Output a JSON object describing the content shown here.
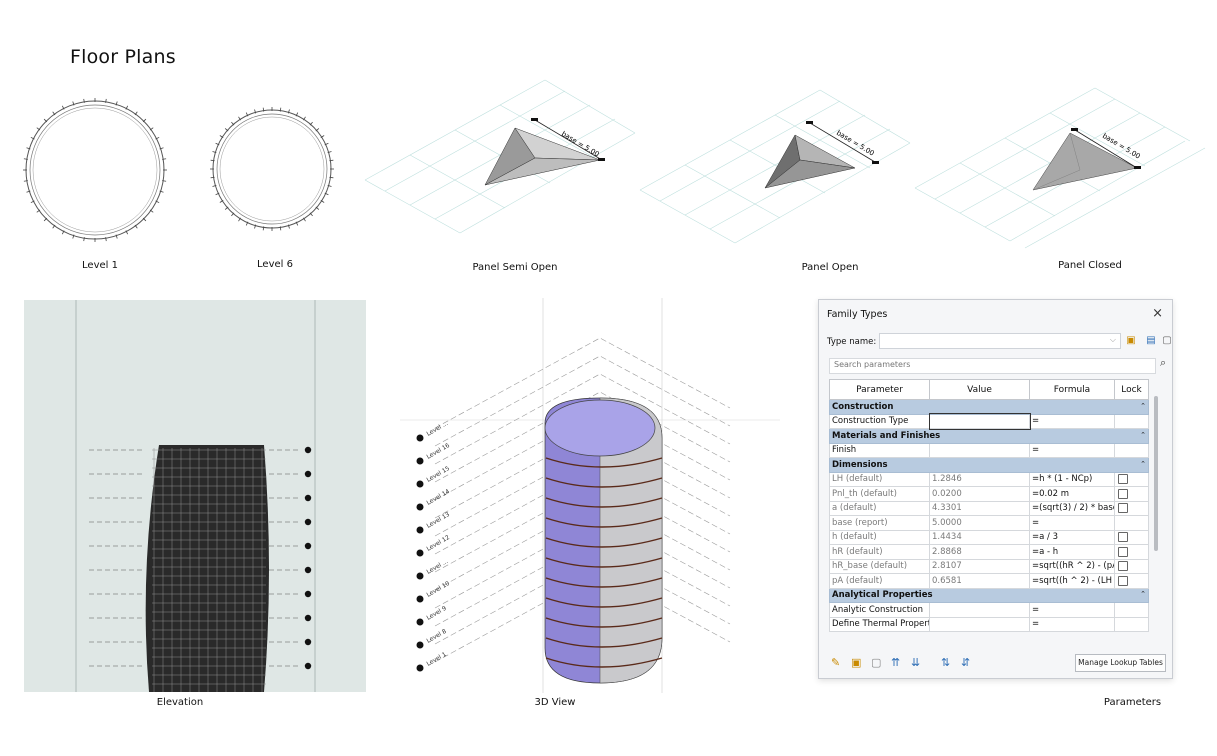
{
  "heading": "Floor Plans",
  "captions": {
    "level1": "Level 1",
    "level6": "Level 6",
    "panel_semi_open": "Panel Semi Open",
    "panel_open": "Panel Open",
    "panel_closed": "Panel Closed",
    "elevation": "Elevation",
    "view_3d": "3D View",
    "parameters": "Parameters"
  },
  "dimension_label": "base = 5.00",
  "elevation_level_count": 10,
  "view3d_levels": [
    "Level ...",
    "Level 16",
    "Level 15",
    "Level 14",
    "Level 13",
    "Level 12",
    "Level ...",
    "Level 10",
    "Level 9",
    "Level 8",
    "Level 1"
  ],
  "dialog": {
    "title": "Family Types",
    "close": "×",
    "type_name_label": "Type name:",
    "type_name_value": "",
    "search_placeholder": "Search parameters",
    "columns": [
      "Parameter",
      "Value",
      "Formula",
      "Lock"
    ],
    "groups": {
      "construction": "Construction",
      "materials": "Materials and Finishes",
      "dimensions": "Dimensions",
      "analytical": "Analytical Properties"
    },
    "rows": {
      "construction_type": {
        "param": "Construction Type",
        "value": "",
        "formula": "="
      },
      "finish": {
        "param": "Finish",
        "value": "",
        "formula": "="
      },
      "lh": {
        "param": "LH (default)",
        "value": "1.2846",
        "formula": "=h * (1 - NCp)"
      },
      "pnl_th": {
        "param": "Pnl_th (default)",
        "value": "0.0200",
        "formula": "=0.02 m"
      },
      "a": {
        "param": "a (default)",
        "value": "4.3301",
        "formula": "=(sqrt(3) / 2) * base"
      },
      "base": {
        "param": "base (report)",
        "value": "5.0000",
        "formula": "="
      },
      "h": {
        "param": "h (default)",
        "value": "1.4434",
        "formula": "=a / 3"
      },
      "hr": {
        "param": "hR (default)",
        "value": "2.8868",
        "formula": "=a - h"
      },
      "hr_base": {
        "param": "hR_base (default)",
        "value": "2.8107",
        "formula": "=sqrt((hR ^ 2) - (pA"
      },
      "pa": {
        "param": "pA (default)",
        "value": "0.6581",
        "formula": "=sqrt((h ^ 2) - (LH ^"
      },
      "analytic_construction": {
        "param": "Analytic Construction",
        "value": "",
        "formula": "="
      },
      "thermal": {
        "param": "Define Thermal Properti",
        "value": "",
        "formula": "="
      }
    },
    "manage_button": "Manage Lookup Tables"
  }
}
